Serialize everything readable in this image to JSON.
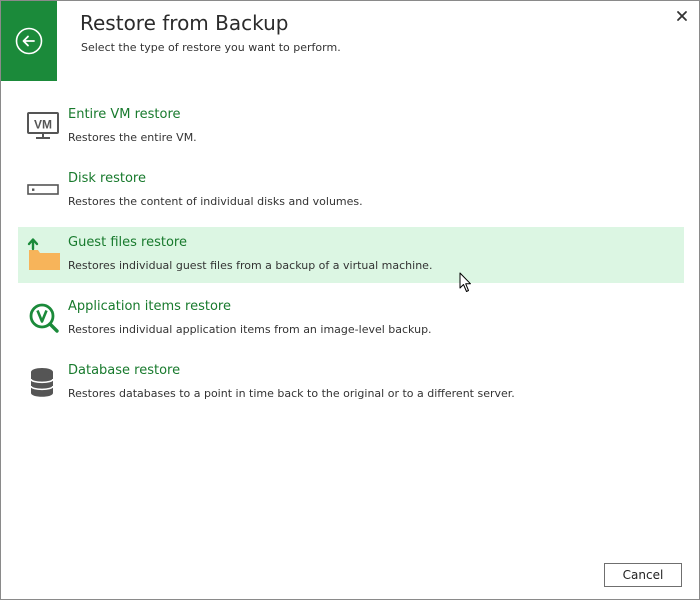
{
  "header": {
    "title": "Restore from Backup",
    "subtitle": "Select the type of restore you want to perform."
  },
  "options": [
    {
      "label": "Entire VM restore",
      "description": "Restores the entire VM.",
      "icon": "vm-icon"
    },
    {
      "label": "Disk restore",
      "description": "Restores the content of individual disks and volumes.",
      "icon": "disk-icon"
    },
    {
      "label": "Guest files restore",
      "description": "Restores individual guest files from a backup of a virtual machine.",
      "icon": "folder-upload-icon",
      "selected": true
    },
    {
      "label": "Application items restore",
      "description": "Restores individual application items from an image-level backup.",
      "icon": "application-search-icon"
    },
    {
      "label": "Database restore",
      "description": "Restores databases to a point in time back to the original or to a different server.",
      "icon": "database-icon"
    }
  ],
  "footer": {
    "cancel_label": "Cancel"
  },
  "colors": {
    "accent": "#1b8a3a",
    "title_green": "#187a2d",
    "selected_bg": "#dcf6e3",
    "folder": "#f7b45a"
  }
}
